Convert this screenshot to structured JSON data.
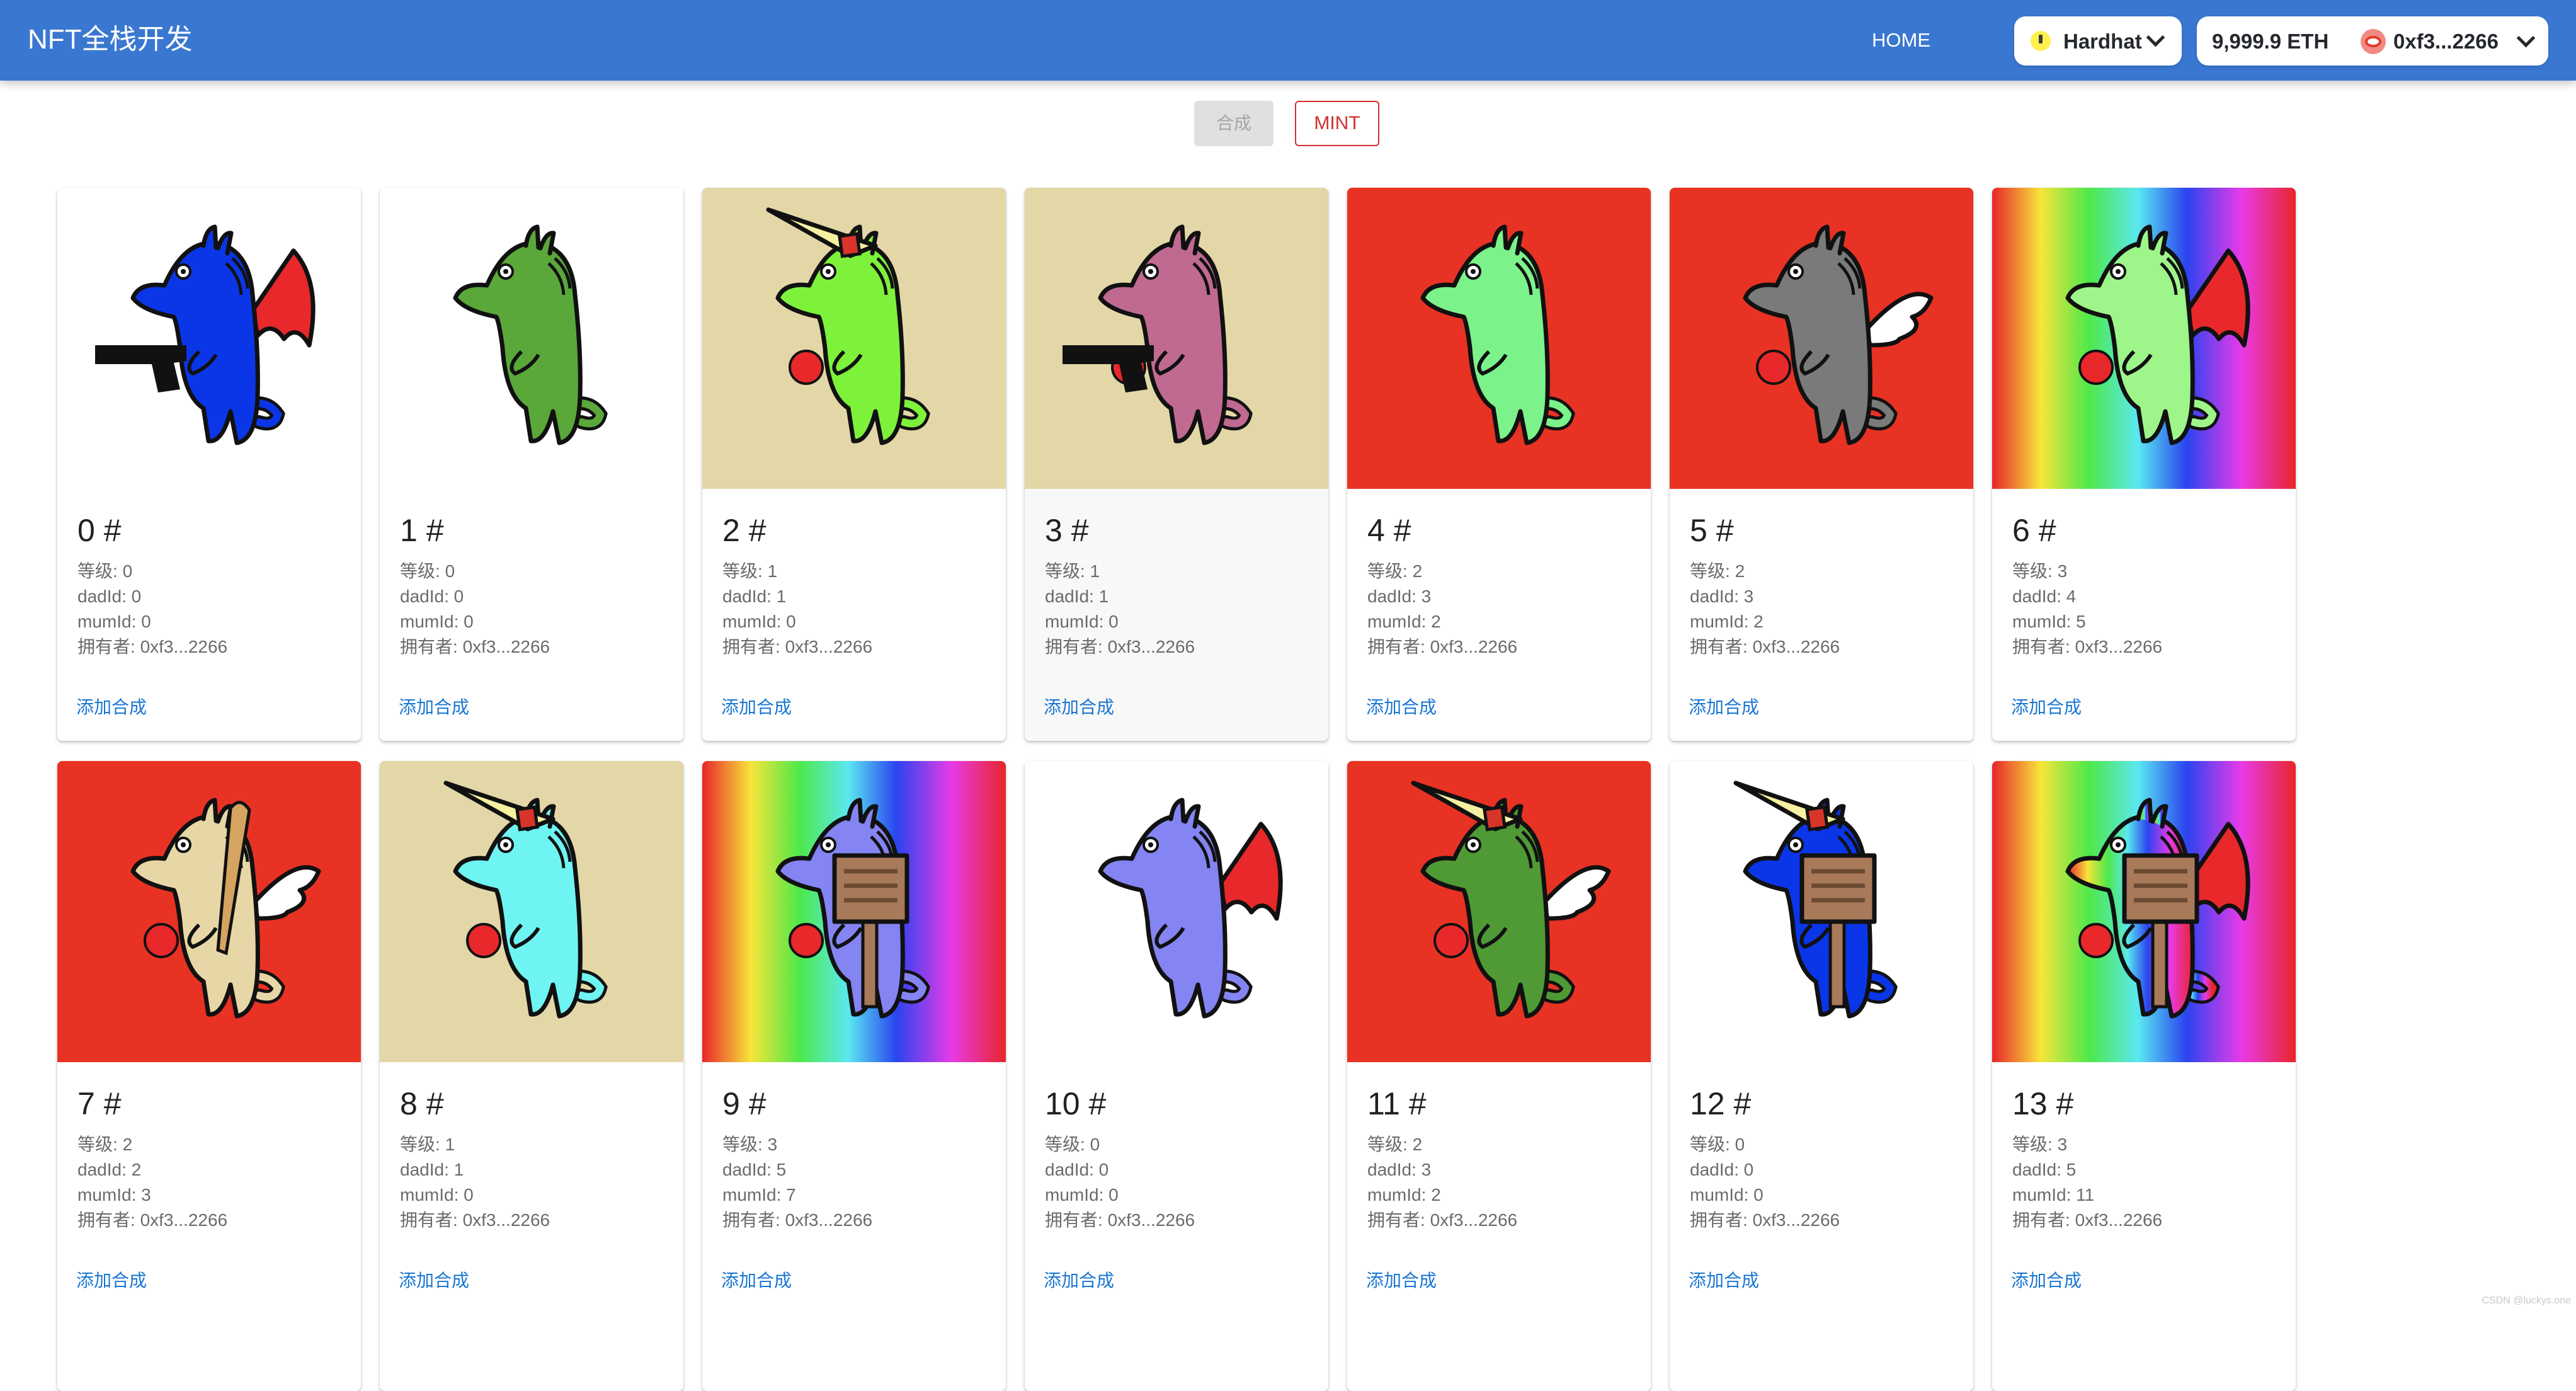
{
  "app_bar": {
    "title": "NFT全栈开发",
    "nav_home": "HOME",
    "network": "Hardhat",
    "balance": "9,999.9 ETH",
    "account": "0xf3...2266"
  },
  "toolbar": {
    "combine_label": "合成",
    "mint_label": "MINT"
  },
  "card_labels": {
    "level": "等级: ",
    "dad": "dadId: ",
    "mum": "mumId: ",
    "owner": "拥有者:  ",
    "action": "添加合成"
  },
  "palette": {
    "app_bar": "#3a77d0",
    "accent": "#1976d2",
    "mint_red": "#d32f2f",
    "bg_white": "#ffffff",
    "bg_tan": "#e3d7a8",
    "bg_red": "#e83224"
  },
  "nfts": [
    {
      "title": "0 #",
      "level": "0",
      "dad": "0",
      "mum": "0",
      "owner": "0xf3...2266",
      "bg": "white",
      "body": "#0a36e8",
      "horn": false,
      "wing": "dragon",
      "item": "gun",
      "mark": false
    },
    {
      "title": "1 #",
      "level": "0",
      "dad": "0",
      "mum": "0",
      "owner": "0xf3...2266",
      "bg": "white",
      "body": "#5aa83a",
      "horn": false,
      "wing": "none",
      "item": "none",
      "mark": false
    },
    {
      "title": "2 #",
      "level": "1",
      "dad": "1",
      "mum": "0",
      "owner": "0xf3...2266",
      "bg": "tan",
      "body": "#7ef23a",
      "horn": true,
      "wing": "none",
      "item": "none",
      "mark": true
    },
    {
      "title": "3 #",
      "level": "1",
      "dad": "1",
      "mum": "0",
      "owner": "0xf3...2266",
      "bg": "tan",
      "body": "#c06a92",
      "horn": false,
      "wing": "none",
      "item": "gun",
      "mark": true
    },
    {
      "title": "4 #",
      "level": "2",
      "dad": "3",
      "mum": "2",
      "owner": "0xf3...2266",
      "bg": "red",
      "body": "#7cf28a",
      "horn": false,
      "wing": "none",
      "item": "none",
      "mark": false
    },
    {
      "title": "5 #",
      "level": "2",
      "dad": "3",
      "mum": "2",
      "owner": "0xf3...2266",
      "bg": "red",
      "body": "#7a7a7a",
      "horn": false,
      "wing": "angel",
      "item": "none",
      "mark": true
    },
    {
      "title": "6 #",
      "level": "3",
      "dad": "4",
      "mum": "5",
      "owner": "0xf3...2266",
      "bg": "rainbow",
      "body": "#9ef58a",
      "horn": false,
      "wing": "dragon",
      "item": "none",
      "mark": true
    },
    {
      "title": "7 #",
      "level": "2",
      "dad": "2",
      "mum": "3",
      "owner": "0xf3...2266",
      "bg": "red",
      "body": "#e8d7a6",
      "horn": false,
      "wing": "angel",
      "item": "bat",
      "mark": true
    },
    {
      "title": "8 #",
      "level": "1",
      "dad": "1",
      "mum": "0",
      "owner": "0xf3...2266",
      "bg": "tan",
      "body": "#6ef4f2",
      "horn": true,
      "wing": "none",
      "item": "none",
      "mark": true
    },
    {
      "title": "9 #",
      "level": "3",
      "dad": "5",
      "mum": "7",
      "owner": "0xf3...2266",
      "bg": "rainbow",
      "body": "#8484f2",
      "horn": false,
      "wing": "none",
      "item": "sign",
      "mark": true
    },
    {
      "title": "10 #",
      "level": "0",
      "dad": "0",
      "mum": "0",
      "owner": "0xf3...2266",
      "bg": "white",
      "body": "#8484f2",
      "horn": false,
      "wing": "dragon",
      "item": "none",
      "mark": false
    },
    {
      "title": "11 #",
      "level": "2",
      "dad": "3",
      "mum": "2",
      "owner": "0xf3...2266",
      "bg": "red",
      "body": "#4f9a34",
      "horn": true,
      "wing": "angel",
      "item": "none",
      "mark": true
    },
    {
      "title": "12 #",
      "level": "0",
      "dad": "0",
      "mum": "0",
      "owner": "0xf3...2266",
      "bg": "white",
      "body": "#0a36e8",
      "horn": true,
      "wing": "none",
      "item": "sign",
      "mark": false
    },
    {
      "title": "13 #",
      "level": "3",
      "dad": "5",
      "mum": "11",
      "owner": "0xf3...2266",
      "bg": "rainbow",
      "body": "rainbow",
      "horn": false,
      "wing": "dragon",
      "item": "sign",
      "mark": true
    }
  ],
  "watermark": "CSDN @luckys.one"
}
